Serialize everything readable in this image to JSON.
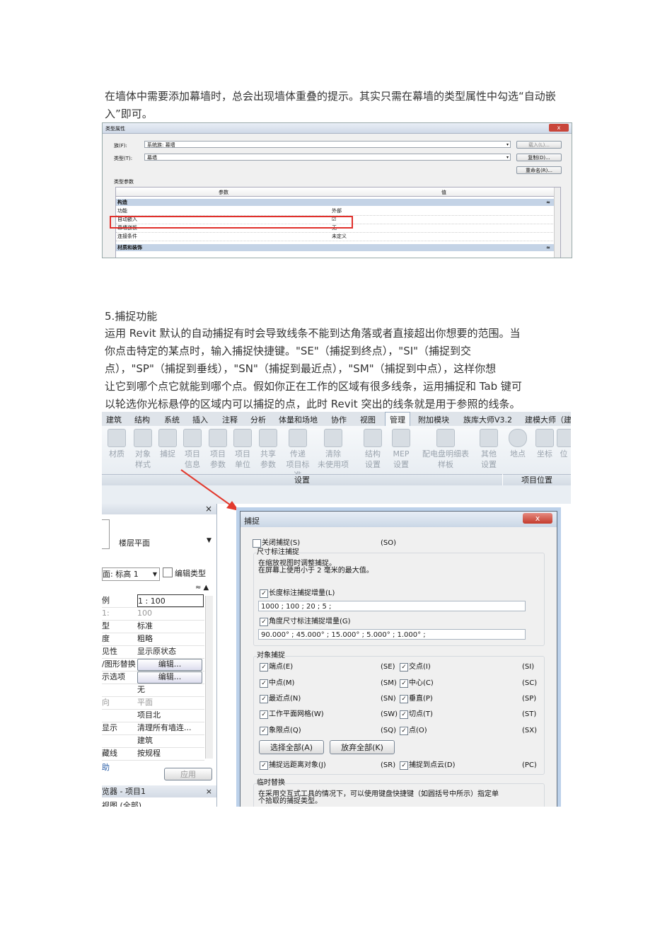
{
  "doc": {
    "para1": "在墙体中需要添加幕墙时，总会出现墙体重叠的提示。其实只需在幕墙的类型属性中勾选“自动嵌入”即可。",
    "heading5": "5.捕捉功能",
    "para2_lines": [
      "运用 Revit 默认的自动捕捉有时会导致线条不能到达角落或者直接超出你想要的范围。当",
      "你点击特定的某点时，输入捕捉快捷键。\"SE\"（捕捉到终点），\"SI\"（捕捉到交",
      "点），\"SP\"（捕捉到垂线），\"SN\"（捕捉到最近点），\"SM\"（捕捉到中点），这样你想",
      "让它到哪个点它就能到哪个点。假如你正在工作的区域有很多线条，运用捕捉和 Tab 键可",
      "以轮选你光标悬停的区域内可以捕捉的点，此时 Revit 突出的线条就是用于参照的线条。"
    ]
  },
  "type_dialog": {
    "title": "类型属性",
    "close": "x",
    "family_label": "族(F):",
    "family_value": "系统族: 幕墙",
    "type_label": "类型(T):",
    "type_value": "幕墙",
    "load_btn": "载入(L)...",
    "duplicate_btn": "复制(D)...",
    "rename_btn": "重命名(R)...",
    "type_params": "类型参数",
    "col_param": "参数",
    "col_value": "值",
    "section1": "构造",
    "rows": [
      {
        "p": "功能",
        "v": "外部"
      },
      {
        "p": "自动嵌入",
        "v": "☑"
      },
      {
        "p": "幕墙嵌板",
        "v": "无"
      },
      {
        "p": "连接条件",
        "v": "未定义"
      }
    ],
    "section2": "材质和装饰"
  },
  "ribbon": {
    "tabs": [
      "建筑",
      "结构",
      "系统",
      "插入",
      "注释",
      "分析",
      "体量和场地",
      "协作",
      "视图",
      "管理",
      "附加模块",
      "族库大师V3.2",
      "建模大师（建"
    ],
    "active_tab": "管理",
    "buttons": [
      {
        "l1": "材质",
        "l2": ""
      },
      {
        "l1": "对象",
        "l2": "样式"
      },
      {
        "l1": "捕捉",
        "l2": ""
      },
      {
        "l1": "项目",
        "l2": "信息"
      },
      {
        "l1": "项目",
        "l2": "参数"
      },
      {
        "l1": "项目",
        "l2": "单位"
      },
      {
        "l1": "共享",
        "l2": "参数"
      },
      {
        "l1": "传递",
        "l2": "项目标准"
      },
      {
        "l1": "清除",
        "l2": "未使用项"
      },
      {
        "l1": "结构",
        "l2": "设置"
      },
      {
        "l1": "MEP",
        "l2": "设置"
      },
      {
        "l1": "配电盘明细表",
        "l2": "样板"
      },
      {
        "l1": "其他",
        "l2": "设置"
      },
      {
        "l1": "地点",
        "l2": ""
      },
      {
        "l1": "坐标",
        "l2": ""
      },
      {
        "l1": "位",
        "l2": ""
      }
    ],
    "panel_settings": "设置",
    "panel_location": "项目位置"
  },
  "properties": {
    "close": "×",
    "view_type": "楼层平面",
    "level_select": "面: 标高 1",
    "edit_type": "编辑类型",
    "rows": [
      {
        "a": "例",
        "b": "1 : 100"
      },
      {
        "a": "1:",
        "b": "100"
      },
      {
        "a": "型",
        "b": "标准"
      },
      {
        "a": "度",
        "b": "粗略"
      },
      {
        "a": "见性",
        "b": "显示原状态"
      },
      {
        "a": "/图形替换",
        "b": "编辑..."
      },
      {
        "a": "示选项",
        "b": "编辑..."
      },
      {
        "a": "",
        "b": "无"
      },
      {
        "a": "向",
        "b": "平面"
      },
      {
        "a": "",
        "b": "项目北"
      },
      {
        "a": "显示",
        "b": "清理所有墙连..."
      },
      {
        "a": "",
        "b": "建筑"
      },
      {
        "a": "藏线",
        "b": "按规程"
      }
    ],
    "apply": "应用",
    "browser_title": "览器 - 项目1",
    "browser_item": "视图 (全部)"
  },
  "snap_dialog": {
    "title": "捕捉",
    "close": "x",
    "snaps_off": "关闭捕捉(S)",
    "snaps_off_code": "(SO)",
    "dim_group": "尺寸标注捕捉",
    "dim_desc1": "在缩放视图时调整捕捉。",
    "dim_desc2": "在屏幕上使用小于 2 毫米的最大值。",
    "length_label": "长度标注捕捉增量(L)",
    "length_value": "1000 ; 100 ; 20 ; 5 ;",
    "angle_label": "角度尺寸标注捕捉增量(G)",
    "angle_value": "90.000° ; 45.000° ; 15.000° ; 5.000° ; 1.000° ;",
    "obj_group": "对象捕捉",
    "left_items": [
      {
        "label": "端点(E)",
        "code": "(SE)"
      },
      {
        "label": "中点(M)",
        "code": "(SM)"
      },
      {
        "label": "最近点(N)",
        "code": "(SN)"
      },
      {
        "label": "工作平面网格(W)",
        "code": "(SW)"
      },
      {
        "label": "象限点(Q)",
        "code": "(SQ)"
      }
    ],
    "right_items": [
      {
        "label": "交点(I)",
        "code": "(SI)"
      },
      {
        "label": "中心(C)",
        "code": "(SC)"
      },
      {
        "label": "垂直(P)",
        "code": "(SP)"
      },
      {
        "label": "切点(T)",
        "code": "(ST)"
      },
      {
        "label": "点(O)",
        "code": "(SX)"
      }
    ],
    "select_all": "选择全部(A)",
    "deselect_all": "放弃全部(K)",
    "remote": "捕捉远距离对象(J)",
    "remote_code": "(SR)",
    "pointcloud": "捕捉到点云(D)",
    "pointcloud_code": "(PC)",
    "temp_group": "临时替换",
    "temp_desc1": "在采用交互式工具的情况下，可以使用键盘快捷键（如圆括号中所示）指定单",
    "temp_desc2": "个拾取的捕捉类型。"
  }
}
